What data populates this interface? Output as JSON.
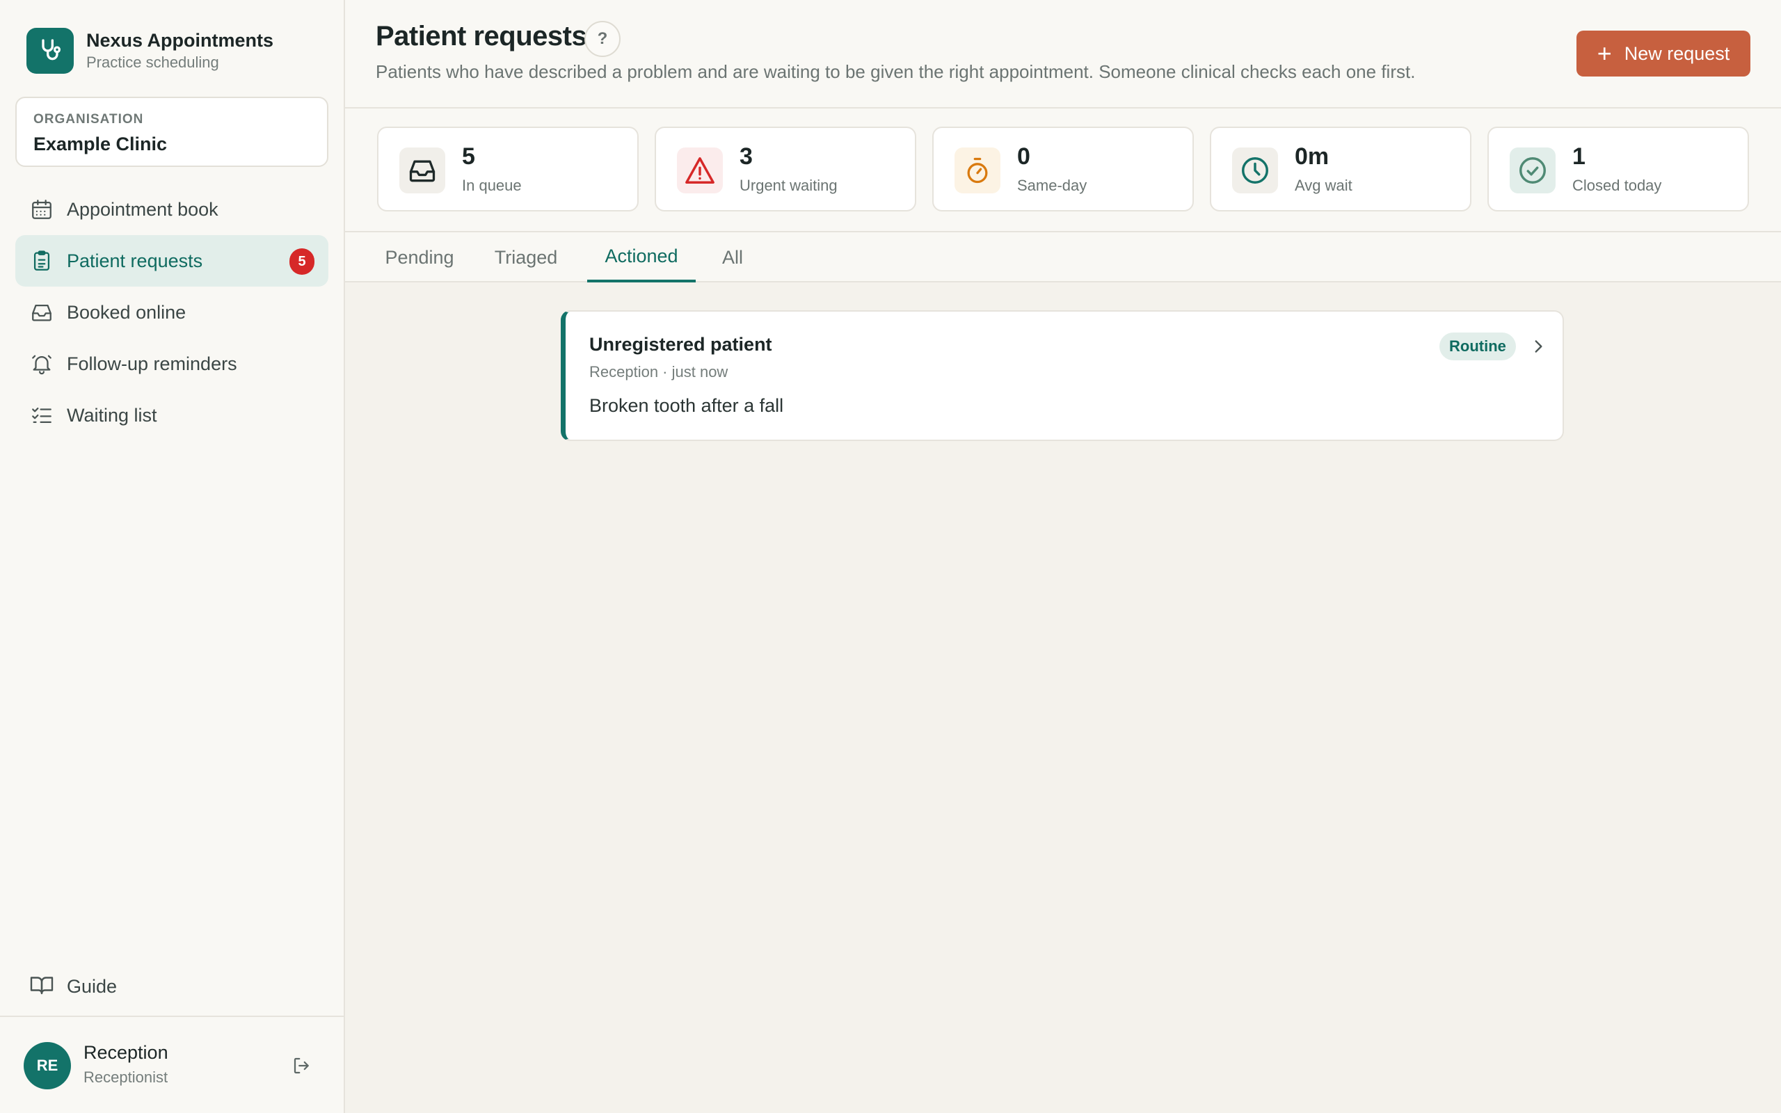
{
  "brand": {
    "title": "Nexus Appointments",
    "subtitle": "Practice scheduling",
    "logo_icon": "stethoscope-icon",
    "color": "#137369"
  },
  "organisation": {
    "label": "ORGANISATION",
    "name": "Example Clinic"
  },
  "sidebar": {
    "items": [
      {
        "label": "Appointment book",
        "icon": "calendar-icon"
      },
      {
        "label": "Patient requests",
        "icon": "clipboard-icon",
        "badge": "5",
        "active": true
      },
      {
        "label": "Booked online",
        "icon": "inbox-icon"
      },
      {
        "label": "Follow-up reminders",
        "icon": "bell-icon"
      },
      {
        "label": "Waiting list",
        "icon": "checklist-icon"
      }
    ],
    "guide": {
      "label": "Guide",
      "icon": "book-icon"
    }
  },
  "user": {
    "initials": "RE",
    "name": "Reception",
    "role": "Receptionist",
    "logout_icon": "logout-icon"
  },
  "header": {
    "title": "Patient requests",
    "help": "?",
    "description": "Patients who have described a problem and are waiting to be given the right appointment. Someone clinical checks each one first.",
    "new_button": {
      "plus": "+",
      "label": "New request"
    },
    "accent_color": "#c7603f"
  },
  "stats": [
    {
      "value": "5",
      "label": "In queue",
      "icon": "inbox-tray-icon"
    },
    {
      "value": "3",
      "label": "Urgent waiting",
      "icon": "warning-icon"
    },
    {
      "value": "0",
      "label": "Same-day",
      "icon": "stopwatch-icon"
    },
    {
      "value": "0m",
      "label": "Avg wait",
      "icon": "clock-icon"
    },
    {
      "value": "1",
      "label": "Closed today",
      "icon": "check-circle-icon"
    }
  ],
  "tabs": [
    {
      "label": "Pending"
    },
    {
      "label": "Triaged"
    },
    {
      "label": "Actioned",
      "active": true
    },
    {
      "label": "All"
    }
  ],
  "requests": [
    {
      "patient": "Unregistered patient",
      "meta": "Reception · just now",
      "description": "Broken tooth after a fall",
      "priority": "Routine"
    }
  ]
}
